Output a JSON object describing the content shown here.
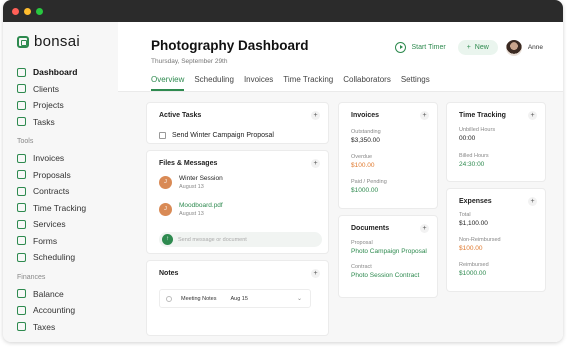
{
  "window": {
    "dot_colors": [
      "#ff5f57",
      "#febc2e",
      "#28c840"
    ]
  },
  "brand": {
    "name": "bonsai",
    "accent": "#2e8a4f"
  },
  "sidebar": {
    "items": [
      {
        "label": "Dashboard",
        "icon": "grid-icon"
      },
      {
        "label": "Clients",
        "icon": "clients-icon"
      },
      {
        "label": "Projects",
        "icon": "folder-icon"
      },
      {
        "label": "Tasks",
        "icon": "checkbox-icon"
      }
    ],
    "tools_label": "Tools",
    "tools": [
      {
        "label": "Invoices",
        "icon": "invoice-icon"
      },
      {
        "label": "Proposals",
        "icon": "send-icon"
      },
      {
        "label": "Contracts",
        "icon": "document-icon"
      },
      {
        "label": "Time Tracking",
        "icon": "clock-icon"
      },
      {
        "label": "Services",
        "icon": "services-icon"
      },
      {
        "label": "Forms",
        "icon": "form-icon"
      },
      {
        "label": "Scheduling",
        "icon": "calendar-icon"
      }
    ],
    "finances_label": "Finances",
    "finances": [
      {
        "label": "Balance",
        "icon": "balance-icon"
      },
      {
        "label": "Accounting",
        "icon": "accounting-icon"
      },
      {
        "label": "Taxes",
        "icon": "taxes-icon"
      }
    ]
  },
  "header": {
    "title": "Photography Dashboard",
    "date": "Thursday, September 29th",
    "start_timer": "Start Timer",
    "new": "New",
    "user_name": "Anne"
  },
  "tabs": [
    "Overview",
    "Scheduling",
    "Invoices",
    "Time Tracking",
    "Collaborators",
    "Settings"
  ],
  "active_tasks": {
    "title": "Active Tasks",
    "task": "Send Winter Campaign Proposal"
  },
  "files": {
    "title": "Files & Messages",
    "items": [
      {
        "badge": "J",
        "name": "Winter Session",
        "date": "August 13"
      },
      {
        "badge": "J",
        "name": "Moodboard.pdf",
        "date": "August 13"
      }
    ],
    "message_placeholder": "Send message or document"
  },
  "notes": {
    "title": "Notes",
    "item": "Meeting Notes",
    "date": "Aug 15"
  },
  "invoices": {
    "title": "Invoices",
    "outstanding_label": "Outstanding",
    "outstanding": "$3,350.00",
    "overdue_label": "Overdue",
    "overdue": "$100.00",
    "paid_label": "Paid / Pending",
    "paid": "$1000.00"
  },
  "documents": {
    "title": "Documents",
    "proposal_label": "Proposal",
    "proposal": "Photo Campaign Proposal",
    "contract_label": "Contract",
    "contract": "Photo Session Contract"
  },
  "time_tracking": {
    "title": "Time Tracking",
    "unbilled_label": "Unbilled Hours",
    "unbilled": "00:00",
    "billed_label": "Billed Hours",
    "billed": "24:30:00"
  },
  "expenses": {
    "title": "Expenses",
    "total_label": "Total",
    "total": "$1,100.00",
    "nonreimb_label": "Non-Reimbursed",
    "nonreimb": "$100.00",
    "reimb_label": "Reimbursed",
    "reimb": "$1000.00"
  }
}
